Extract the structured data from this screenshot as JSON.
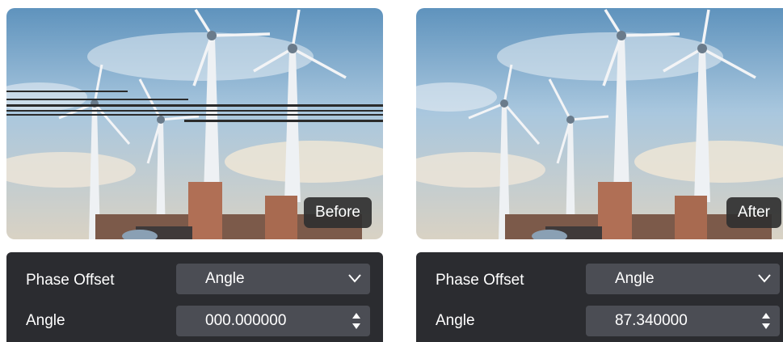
{
  "panels": [
    {
      "badge": "Before",
      "controls": {
        "phase_label": "Phase Offset",
        "phase_value": "Angle",
        "angle_label": "Angle",
        "angle_value": "000.000000"
      }
    },
    {
      "badge": "After",
      "controls": {
        "phase_label": "Phase Offset",
        "phase_value": "Angle",
        "angle_label": "Angle",
        "angle_value": "87.340000"
      }
    }
  ],
  "icons": {
    "dropdown": "chevron-down-icon",
    "stepper": "stepper-arrows-icon"
  },
  "colors": {
    "control_panel_bg": "#2b2c30",
    "field_bg": "#4b4d54",
    "badge_bg": "#303030",
    "text": "#ffffff"
  }
}
